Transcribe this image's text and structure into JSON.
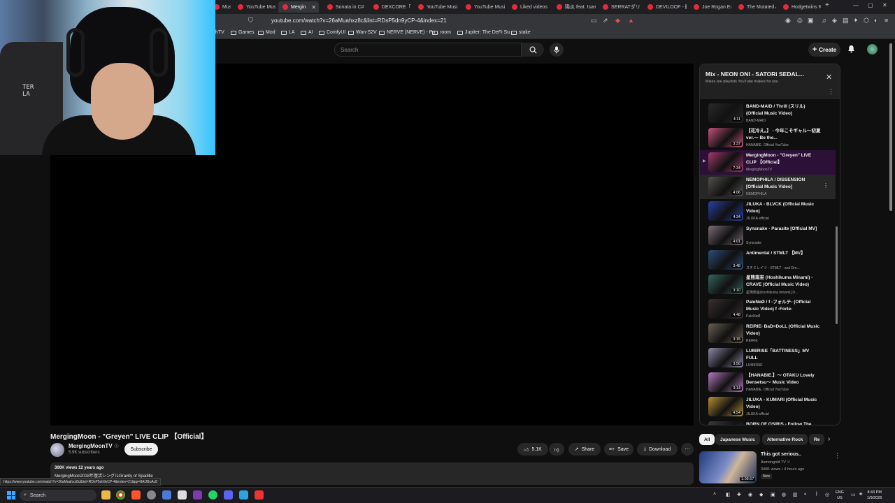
{
  "browser": {
    "tabs": [
      {
        "label": "Music",
        "active": false
      },
      {
        "label": "YouTube Music",
        "active": false
      },
      {
        "label": "Mergin",
        "active": true
      },
      {
        "label": "Sonata in C#",
        "active": false
      },
      {
        "label": "DEXCORE「RAI",
        "active": false
      },
      {
        "label": "YouTube Music",
        "active": false
      },
      {
        "label": "YouTube Music",
        "active": false
      },
      {
        "label": "Liked videos",
        "active": false
      },
      {
        "label": "陽炎 feat. Isam",
        "active": false
      },
      {
        "label": "SERRATダリラ",
        "active": false
      },
      {
        "label": "DEVILOOF - 歓",
        "active": false
      },
      {
        "label": "Joe Rogan Exp",
        "active": false
      },
      {
        "label": "The Mutated A",
        "active": false
      },
      {
        "label": "Hodgetwins R",
        "active": false
      }
    ],
    "url": "youtube.com/watch?v=26aMuahxz8c&list=RDsP5dn9yCP-4&index=21",
    "bookmarks": [
      "hTV",
      "Games",
      "Mod",
      "LA",
      "AI",
      "ComfyUI",
      "Wan-S2V",
      "NERVE (NERVE) - Pu...",
      "room",
      "Jupiter: The DeFi Su...",
      "stake"
    ]
  },
  "header": {
    "search_placeholder": "Search",
    "create_label": "Create"
  },
  "webcam": {
    "chair_text": "TER\nLA"
  },
  "video": {
    "title": "MergingMoon - \"Greyen\" LIVE CLIP 【Official】",
    "channel": "MergingMoonTV",
    "channel_verified": "☉",
    "subscribers": "5.9K subscribers",
    "subscribe_label": "Subscribe",
    "likes": "5.1K",
    "share_label": "Share",
    "save_label": "Save",
    "download_label": "Download",
    "views_date": "300K views  12 years ago",
    "description": "MergingMoon2018年復活シングルGravity of Spadille",
    "hover_url": "https://www.youtube.com/watch?v=26aMuahxz8c&list=RDsP5dn9yCP-4&index=21&pp=8AUBoAc8"
  },
  "playlist": {
    "title": "Mix - NEON ONI - SATORi SEDAL...",
    "subtitle": "Mixes are playlists YouTube makes for you",
    "items": [
      {
        "title": "BAND-MAID / Thrill (スリル) (Official Music Video)",
        "channel": "BAND-MAID",
        "duration": "4:11",
        "color": "#2a2a2a",
        "state": "normal"
      },
      {
        "title": "【花冷え。】 - 今年こそギャル〜初夏ver.〜 Be the...",
        "channel": "HANABIE. Official YouTube",
        "duration": "3:37",
        "color": "#c5517a",
        "state": "normal"
      },
      {
        "title": "MergingMoon - \"Greyen\" LIVE CLIP 【Official】",
        "channel": "MergingMoonTV",
        "duration": "7:34",
        "color": "#a23a6a",
        "state": "active"
      },
      {
        "title": "NEMOPHILA / DISSENSION [Official Music Video]",
        "channel": "NEMOPHILA",
        "duration": "4:06",
        "color": "#55514f",
        "state": "hover"
      },
      {
        "title": "JILUKA - BLVCK (Official Music Video)",
        "channel": "JILUKA-official",
        "duration": "4:34",
        "color": "#2840a6",
        "state": "normal"
      },
      {
        "title": "Synsnake - Parasite [Official MV]",
        "channel": "Synsnake",
        "duration": "4:01",
        "color": "#7a6e78",
        "state": "normal"
      },
      {
        "title": "Antimental / STMLT 【MV】",
        "channel": "スチミレイツ - STMLT - and Dre...",
        "duration": "3:48",
        "color": "#2d4d7a",
        "state": "normal"
      },
      {
        "title": "星熊南巫 (Hoshikuma Minami) - CRAVE (Official Music Video)",
        "channel": "星熊南巫(hoshikuma minami),D...",
        "duration": "3:10",
        "color": "#35655d",
        "state": "normal"
      },
      {
        "title": "PaleNeØ / f -フォルテ- (Official Music Video) f -Forte-",
        "channel": "PaleNeØ",
        "duration": "4:48",
        "color": "#3a3030",
        "state": "normal"
      },
      {
        "title": "REIRIE- BaD=DoLL (Official Music Video)",
        "channel": "REIRIE",
        "duration": "3:15",
        "color": "#6a6055",
        "state": "normal"
      },
      {
        "title": "LUMIRISE「BATTINESS」MV FULL",
        "channel": "LUMIRISE",
        "duration": "3:56",
        "color": "#8d8aa8",
        "state": "normal"
      },
      {
        "title": "【HANABIE.】〜 OTAKU Lovely Densetsu〜 Music Video",
        "channel": "HANABIE. Official YouTube",
        "duration": "3:14",
        "color": "#b37ac0",
        "state": "normal"
      },
      {
        "title": "JILUKA - KUMARI (Official Music Video)",
        "channel": "JILUKA-official",
        "duration": "4:54",
        "color": "#b59034",
        "state": "normal"
      },
      {
        "title": "BORN OF OSIRIS - Follow The",
        "channel": "",
        "duration": "",
        "color": "#3a3a3a",
        "state": "normal"
      }
    ]
  },
  "chips": [
    "All",
    "Japanese Music",
    "Alternative Rock",
    "Re"
  ],
  "recommended": {
    "title": "This got serious..",
    "channel": "Asmongold TV",
    "meta": "346K views • 4 hours ago",
    "badge": "New",
    "duration": "1:08:57"
  },
  "taskbar": {
    "search_label": "Search",
    "lang": "ENG\nUS",
    "time": "8:43 PM",
    "date": "1/9/2026"
  }
}
